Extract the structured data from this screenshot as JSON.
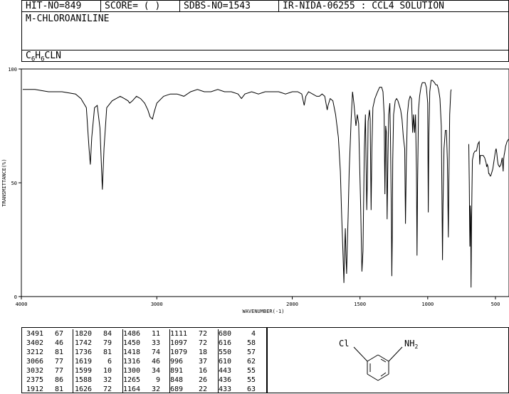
{
  "header": {
    "hit": "HIT-NO=849",
    "score": "SCORE=  (  )",
    "sdbs": "SDBS-NO=1543",
    "nida": "IR-NIDA-06255 : CCL4 SOLUTION"
  },
  "compound_name": "M-CHLOROANILINE",
  "formula": {
    "c": "C",
    "c_sub": "6",
    "h": "H",
    "h_sub": "6",
    "rest": "CLN"
  },
  "structure": {
    "cl_label": "Cl",
    "nh2_label": "NH",
    "nh2_sub": "2"
  },
  "chart_data": {
    "type": "line",
    "title": "",
    "xlabel": "WAVENUMBER(-1)",
    "ylabel": "TRANSMITTANCE(%)",
    "xlim": [
      4000,
      400
    ],
    "ylim": [
      0,
      100
    ],
    "x_ticks": [
      4000,
      3000,
      2000,
      1500,
      1000,
      500
    ],
    "y_ticks": [
      0,
      50,
      100
    ],
    "series": [
      {
        "name": "",
        "points": [
          [
            3990,
            91
          ],
          [
            3900,
            91
          ],
          [
            3800,
            90
          ],
          [
            3700,
            90
          ],
          [
            3600,
            89
          ],
          [
            3560,
            87
          ],
          [
            3520,
            83
          ],
          [
            3500,
            65
          ],
          [
            3491,
            58
          ],
          [
            3480,
            70
          ],
          [
            3460,
            83
          ],
          [
            3440,
            84
          ],
          [
            3420,
            74
          ],
          [
            3402,
            47
          ],
          [
            3390,
            65
          ],
          [
            3370,
            83
          ],
          [
            3330,
            86
          ],
          [
            3300,
            87
          ],
          [
            3270,
            88
          ],
          [
            3240,
            87
          ],
          [
            3212,
            86
          ],
          [
            3200,
            85
          ],
          [
            3180,
            86
          ],
          [
            3150,
            88
          ],
          [
            3120,
            87
          ],
          [
            3090,
            85
          ],
          [
            3066,
            82
          ],
          [
            3050,
            79
          ],
          [
            3032,
            78
          ],
          [
            3020,
            81
          ],
          [
            3000,
            85
          ],
          [
            2950,
            88
          ],
          [
            2900,
            89
          ],
          [
            2850,
            89
          ],
          [
            2800,
            88
          ],
          [
            2750,
            90
          ],
          [
            2700,
            91
          ],
          [
            2650,
            90
          ],
          [
            2600,
            90
          ],
          [
            2550,
            91
          ],
          [
            2500,
            90
          ],
          [
            2450,
            90
          ],
          [
            2400,
            89
          ],
          [
            2375,
            87
          ],
          [
            2350,
            89
          ],
          [
            2300,
            90
          ],
          [
            2250,
            89
          ],
          [
            2200,
            90
          ],
          [
            2100,
            90
          ],
          [
            2050,
            89
          ],
          [
            2000,
            90
          ],
          [
            1960,
            90
          ],
          [
            1930,
            89
          ],
          [
            1912,
            84
          ],
          [
            1900,
            88
          ],
          [
            1880,
            90
          ],
          [
            1850,
            89
          ],
          [
            1820,
            88
          ],
          [
            1800,
            88
          ],
          [
            1780,
            89
          ],
          [
            1760,
            88
          ],
          [
            1742,
            82
          ],
          [
            1736,
            84
          ],
          [
            1720,
            87
          ],
          [
            1700,
            86
          ],
          [
            1680,
            80
          ],
          [
            1660,
            70
          ],
          [
            1645,
            55
          ],
          [
            1635,
            35
          ],
          [
            1626,
            20
          ],
          [
            1619,
            6
          ],
          [
            1614,
            20
          ],
          [
            1608,
            30
          ],
          [
            1604,
            18
          ],
          [
            1599,
            10
          ],
          [
            1594,
            22
          ],
          [
            1588,
            35
          ],
          [
            1580,
            55
          ],
          [
            1565,
            78
          ],
          [
            1555,
            90
          ],
          [
            1545,
            85
          ],
          [
            1530,
            75
          ],
          [
            1520,
            80
          ],
          [
            1510,
            76
          ],
          [
            1495,
            40
          ],
          [
            1486,
            11
          ],
          [
            1478,
            20
          ],
          [
            1468,
            65
          ],
          [
            1460,
            80
          ],
          [
            1450,
            38
          ],
          [
            1444,
            55
          ],
          [
            1440,
            77
          ],
          [
            1430,
            82
          ],
          [
            1425,
            78
          ],
          [
            1418,
            38
          ],
          [
            1412,
            65
          ],
          [
            1405,
            83
          ],
          [
            1390,
            87
          ],
          [
            1370,
            90
          ],
          [
            1355,
            92
          ],
          [
            1340,
            92
          ],
          [
            1330,
            90
          ],
          [
            1322,
            80
          ],
          [
            1316,
            45
          ],
          [
            1310,
            75
          ],
          [
            1305,
            72
          ],
          [
            1300,
            34
          ],
          [
            1294,
            60
          ],
          [
            1288,
            80
          ],
          [
            1280,
            85
          ],
          [
            1275,
            70
          ],
          [
            1268,
            35
          ],
          [
            1265,
            9
          ],
          [
            1262,
            25
          ],
          [
            1258,
            60
          ],
          [
            1252,
            80
          ],
          [
            1240,
            86
          ],
          [
            1230,
            87
          ],
          [
            1220,
            86
          ],
          [
            1210,
            84
          ],
          [
            1200,
            82
          ],
          [
            1190,
            78
          ],
          [
            1180,
            70
          ],
          [
            1170,
            65
          ],
          [
            1164,
            32
          ],
          [
            1158,
            60
          ],
          [
            1150,
            80
          ],
          [
            1140,
            86
          ],
          [
            1130,
            88
          ],
          [
            1120,
            87
          ],
          [
            1111,
            72
          ],
          [
            1105,
            80
          ],
          [
            1097,
            72
          ],
          [
            1090,
            80
          ],
          [
            1083,
            55
          ],
          [
            1079,
            18
          ],
          [
            1075,
            50
          ],
          [
            1068,
            82
          ],
          [
            1060,
            88
          ],
          [
            1050,
            92
          ],
          [
            1040,
            94
          ],
          [
            1030,
            94
          ],
          [
            1020,
            94
          ],
          [
            1010,
            92
          ],
          [
            1000,
            85
          ],
          [
            996,
            37
          ],
          [
            992,
            70
          ],
          [
            985,
            90
          ],
          [
            975,
            95
          ],
          [
            965,
            95
          ],
          [
            950,
            94
          ],
          [
            940,
            93
          ],
          [
            930,
            93
          ],
          [
            920,
            91
          ],
          [
            910,
            87
          ],
          [
            900,
            75
          ],
          [
            895,
            45
          ],
          [
            891,
            16
          ],
          [
            887,
            40
          ],
          [
            880,
            65
          ],
          [
            870,
            73
          ],
          [
            862,
            73
          ],
          [
            855,
            60
          ],
          [
            848,
            26
          ],
          [
            844,
            50
          ],
          [
            838,
            80
          ],
          [
            830,
            90
          ],
          [
            827,
            91
          ]
        ]
      },
      {
        "name": "",
        "points": [
          [
            697,
            67
          ],
          [
            693,
            50
          ],
          [
            689,
            22
          ],
          [
            686,
            40
          ],
          [
            683,
            35
          ],
          [
            680,
            4
          ],
          [
            677,
            30
          ],
          [
            674,
            45
          ],
          [
            670,
            60
          ],
          [
            660,
            63
          ],
          [
            650,
            64
          ],
          [
            640,
            64
          ],
          [
            630,
            67
          ],
          [
            620,
            68
          ],
          [
            616,
            58
          ],
          [
            612,
            62
          ],
          [
            604,
            62
          ],
          [
            600,
            62
          ],
          [
            590,
            62
          ],
          [
            580,
            61
          ],
          [
            575,
            60
          ],
          [
            570,
            59
          ],
          [
            565,
            57
          ],
          [
            560,
            58
          ],
          [
            555,
            57
          ],
          [
            550,
            54
          ],
          [
            545,
            54
          ],
          [
            540,
            53
          ],
          [
            535,
            53
          ],
          [
            530,
            54
          ],
          [
            520,
            56
          ],
          [
            510,
            60
          ],
          [
            500,
            64
          ],
          [
            495,
            65
          ],
          [
            490,
            63
          ],
          [
            485,
            60
          ],
          [
            480,
            58
          ],
          [
            470,
            57
          ],
          [
            460,
            58
          ],
          [
            450,
            61
          ],
          [
            443,
            55
          ],
          [
            440,
            60
          ],
          [
            436,
            62
          ],
          [
            433,
            63
          ],
          [
            425,
            66
          ],
          [
            415,
            68
          ],
          [
            405,
            69
          ],
          [
            400,
            69
          ]
        ]
      }
    ]
  },
  "peak_table": [
    [
      [
        "3491",
        "67"
      ],
      [
        "3402",
        "46"
      ],
      [
        "3212",
        "81"
      ],
      [
        "3066",
        "77"
      ],
      [
        "3032",
        "77"
      ],
      [
        "2375",
        "86"
      ],
      [
        "1912",
        "81"
      ]
    ],
    [
      [
        "1820",
        "84"
      ],
      [
        "1742",
        "79"
      ],
      [
        "1736",
        "81"
      ],
      [
        "1619",
        "6"
      ],
      [
        "1599",
        "10"
      ],
      [
        "1588",
        "32"
      ],
      [
        "1626",
        "72"
      ]
    ],
    [
      [
        "1486",
        "11"
      ],
      [
        "1450",
        "33"
      ],
      [
        "1418",
        "74"
      ],
      [
        "1316",
        "46"
      ],
      [
        "1300",
        "34"
      ],
      [
        "1265",
        "9"
      ],
      [
        "1164",
        "32"
      ]
    ],
    [
      [
        "1111",
        "72"
      ],
      [
        "1097",
        "72"
      ],
      [
        "1079",
        "18"
      ],
      [
        "996",
        "37"
      ],
      [
        "891",
        "16"
      ],
      [
        "848",
        "26"
      ],
      [
        "689",
        "22"
      ]
    ],
    [
      [
        "680",
        "4"
      ],
      [
        "616",
        "58"
      ],
      [
        "550",
        "57"
      ],
      [
        "610",
        "62"
      ],
      [
        "443",
        "55"
      ],
      [
        "436",
        "55"
      ],
      [
        "433",
        "63"
      ]
    ]
  ]
}
